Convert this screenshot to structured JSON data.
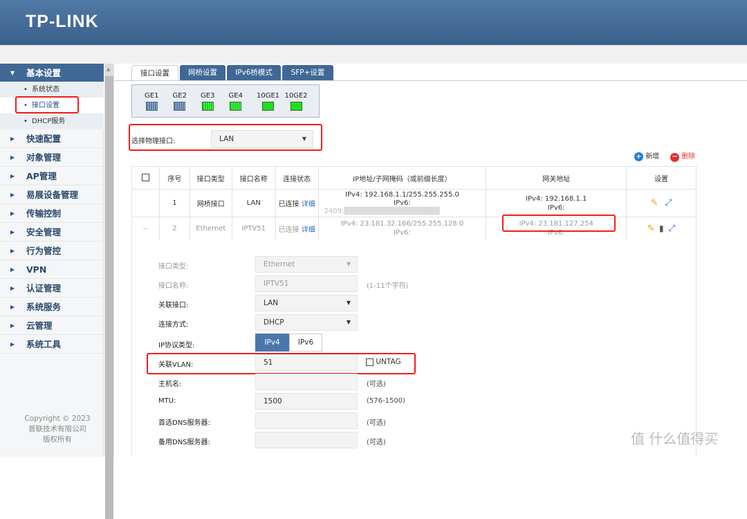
{
  "header": {
    "logo": "TP-LINK",
    "brand_color": "#3f6896"
  },
  "sidebar": {
    "open": "基本设置",
    "subs": [
      {
        "label": "系统状态"
      },
      {
        "label": "接口设置",
        "selected": true
      },
      {
        "label": "DHCP服务"
      }
    ],
    "items": [
      "快速配置",
      "对象管理",
      "AP管理",
      "易展设备管理",
      "传输控制",
      "安全管理",
      "行为管控",
      "VPN",
      "认证管理",
      "系统服务",
      "云管理",
      "系统工具"
    ],
    "copyright": [
      "Copyright © 2023",
      "普联技术有限公司",
      "版权所有"
    ]
  },
  "tabs": [
    {
      "label": "接口设置",
      "active": true
    },
    {
      "label": "网桥设置"
    },
    {
      "label": "IPv6桥模式"
    },
    {
      "label": "SFP+设置"
    }
  ],
  "ports": [
    {
      "name": "GE1",
      "type": "rj45",
      "status": "idle"
    },
    {
      "name": "GE2",
      "type": "rj45",
      "status": "idle"
    },
    {
      "name": "GE3",
      "type": "rj45",
      "status": "up"
    },
    {
      "name": "GE4",
      "type": "rj45",
      "status": "up"
    },
    {
      "name": "10GE1",
      "type": "sfp",
      "status": "up"
    },
    {
      "name": "10GE2",
      "type": "sfp",
      "status": "up"
    }
  ],
  "phys_select": {
    "label": "选择物理接口:",
    "value": "LAN"
  },
  "actions": {
    "add": "新增",
    "delete": "删除"
  },
  "table": {
    "headers": [
      "",
      "序号",
      "接口类型",
      "接口名称",
      "连接状态",
      "IP地址/子网掩码（或前缀长度）",
      "网关地址",
      "设置"
    ],
    "rows": [
      {
        "sel": "",
        "no": "1",
        "type": "网桥接口",
        "name": "LAN",
        "status": "已连接",
        "detail": "详细",
        "ip4": "IPv4:  192.168.1.1/255.255.255.0",
        "ip6": "IPv6:",
        "ip6v": "2409:▒▒▒▒▒▒▒▒▒▒▒▒▒▒▒▒▒▒",
        "gw4": "IPv4:  192.168.1.1",
        "gw6": "IPv6:"
      },
      {
        "sel": "--",
        "no": "2",
        "type": "Ethernet",
        "name": "IPTV51",
        "status": "已连接",
        "detail": "详细",
        "ip4": "IPv4:  23.181.32.166/255.255.128.0",
        "ip6": "IPv6:",
        "gw4": "IPv4:  23.181.127.254",
        "gw6": "IPv6:"
      }
    ]
  },
  "form": {
    "iface_type": {
      "label": "接口类型:",
      "value": "Ethernet"
    },
    "iface_name": {
      "label": "接口名称:",
      "value": "IPTV51",
      "hint": "(1-11个字符)"
    },
    "bind_iface": {
      "label": "关联接口:",
      "value": "LAN"
    },
    "conn_mode": {
      "label": "连接方式:",
      "value": "DHCP"
    },
    "ip_proto": {
      "label": "IP协议类型:",
      "options": [
        "IPv4",
        "IPv6"
      ],
      "selected": "IPv4"
    },
    "vlan": {
      "label": "关联VLAN:",
      "value": "51",
      "untag_label": "UNTAG",
      "untag": false
    },
    "hostname": {
      "label": "主机名:",
      "value": "",
      "hint": "(可选)"
    },
    "mtu": {
      "label": "MTU:",
      "value": "1500",
      "hint": "(576-1500)"
    },
    "dns1": {
      "label": "首选DNS服务器:",
      "value": "",
      "hint": "(可选)"
    },
    "dns2": {
      "label": "备用DNS服务器:",
      "value": "",
      "hint": "(可选)"
    }
  },
  "watermark": "值 什么值得买"
}
